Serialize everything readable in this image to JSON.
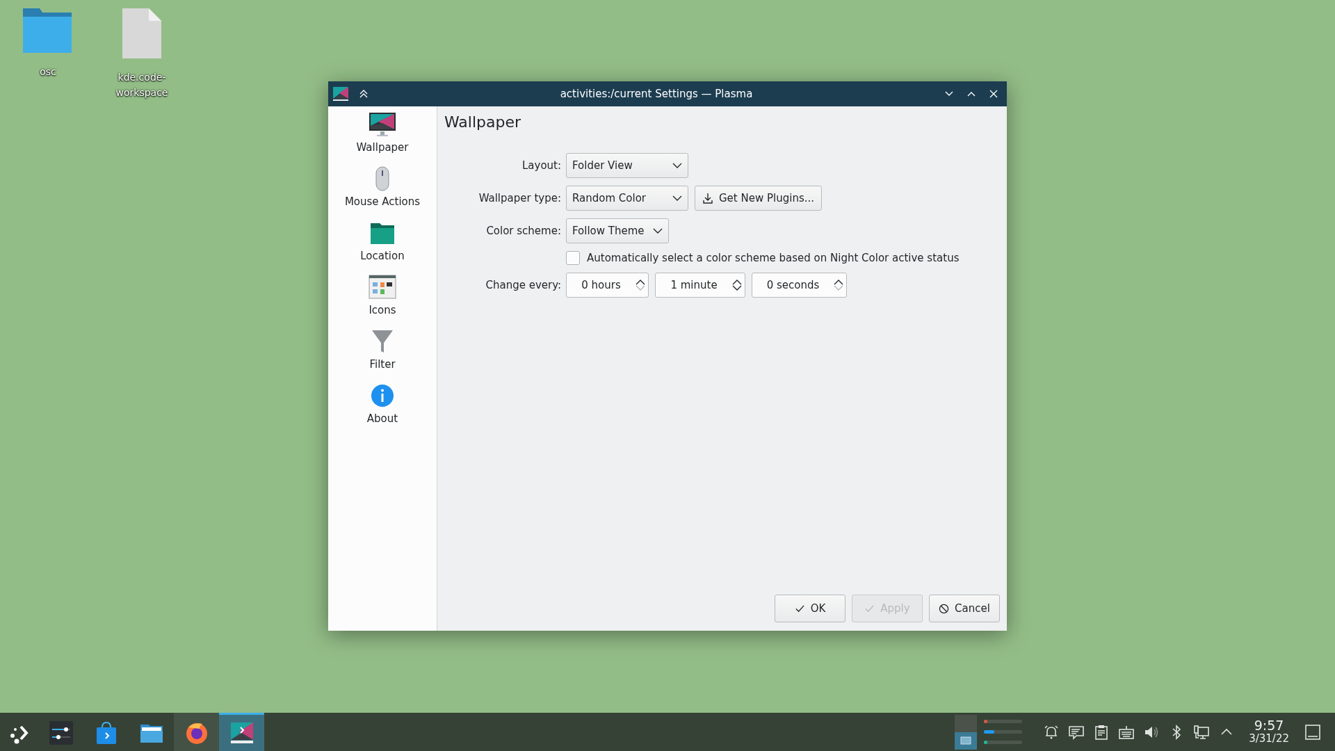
{
  "desktop_icons": [
    {
      "kind": "folder",
      "label": "osc"
    },
    {
      "kind": "file",
      "label": "kde.code-workspace"
    }
  ],
  "window": {
    "title": "activities:/current Settings — Plasma",
    "sidebar": {
      "items": [
        {
          "kind": "wallpaper",
          "label": "Wallpaper"
        },
        {
          "kind": "mouse",
          "label": "Mouse Actions"
        },
        {
          "kind": "location",
          "label": "Location"
        },
        {
          "kind": "icons",
          "label": "Icons"
        },
        {
          "kind": "filter",
          "label": "Filter"
        },
        {
          "kind": "about",
          "label": "About"
        }
      ]
    },
    "page_title": "Wallpaper",
    "layout": {
      "label": "Layout:",
      "value": "Folder View"
    },
    "wallpaper_type": {
      "label": "Wallpaper type:",
      "value": "Random Color",
      "button": "Get New Plugins..."
    },
    "color_scheme": {
      "label": "Color scheme:",
      "value": "Follow Theme"
    },
    "night_color_checkbox": {
      "label": "Automatically select a color scheme based on Night Color active status",
      "checked": false
    },
    "change_every": {
      "label": "Change every:",
      "spinboxes": [
        {
          "value": "0 hours",
          "down_disabled": true
        },
        {
          "value": "1 minute",
          "down_disabled": false
        },
        {
          "value": "0 seconds",
          "down_disabled": true
        }
      ]
    },
    "buttons": [
      {
        "kind": "ok",
        "label": "OK",
        "disabled": false
      },
      {
        "kind": "apply",
        "label": "Apply",
        "disabled": true
      },
      {
        "kind": "cancel",
        "label": "Cancel",
        "disabled": false
      }
    ]
  },
  "taskbar": {
    "tasks": [
      {
        "kind": "launcher",
        "selected": false,
        "highlighted": false
      },
      {
        "kind": "mixer",
        "selected": false,
        "highlighted": false
      },
      {
        "kind": "store",
        "selected": false,
        "highlighted": false
      },
      {
        "kind": "files",
        "selected": false,
        "highlighted": false
      },
      {
        "kind": "browser",
        "selected": false,
        "highlighted": true
      },
      {
        "kind": "plasma",
        "selected": true,
        "highlighted": false
      }
    ],
    "pager": [
      {
        "selected": false
      },
      {
        "selected": true
      }
    ],
    "meters": [
      {
        "color": "#e0583a",
        "level": 0.04
      },
      {
        "color": "#1e9bf0",
        "level": 0.27
      },
      {
        "color": "#1abc9c",
        "level": 0.04
      }
    ],
    "clock": {
      "time": "9:57",
      "date": "3/31/22"
    }
  }
}
